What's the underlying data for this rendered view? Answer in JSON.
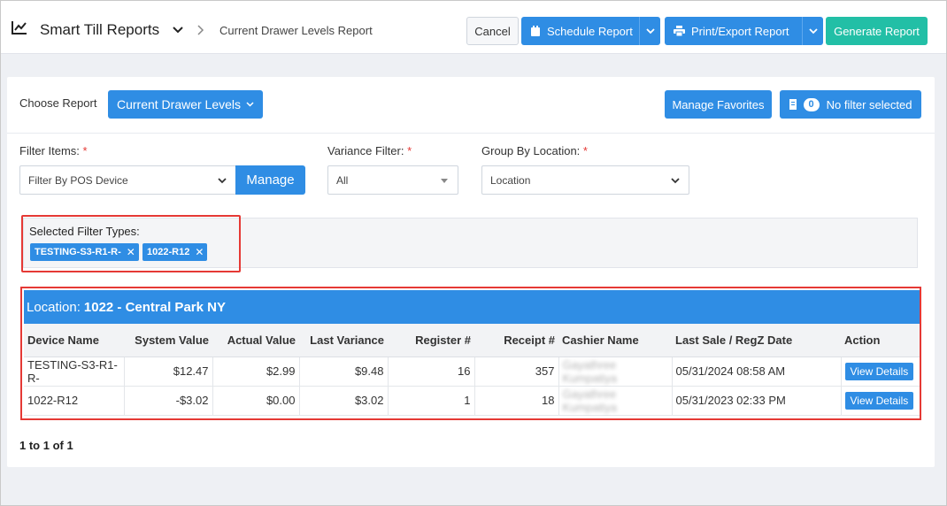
{
  "header": {
    "app_title": "Smart Till Reports",
    "breadcrumb": "Current Drawer Levels Report",
    "cancel_label": "Cancel",
    "schedule_label": "Schedule Report",
    "print_label": "Print/Export Report",
    "generate_label": "Generate Report"
  },
  "report_select": {
    "label": "Choose Report",
    "value": "Current Drawer Levels",
    "manage_favorites": "Manage Favorites",
    "filter_count": "0",
    "filter_status": "No filter selected"
  },
  "filters": {
    "items_label": "Filter Items:",
    "items_value": "Filter By POS Device",
    "manage_label": "Manage",
    "variance_label": "Variance Filter:",
    "variance_value": "All",
    "group_label": "Group By Location:",
    "group_value": "Location",
    "required_mark": "*"
  },
  "selected_filters": {
    "label": "Selected Filter Types:",
    "chips": [
      "TESTING-S3-R1-R-",
      "1022-R12"
    ]
  },
  "location": {
    "prefix": "Location:",
    "name": "1022 - Central Park NY"
  },
  "table": {
    "headers": [
      "Device Name",
      "System Value",
      "Actual Value",
      "Last Variance",
      "Register #",
      "Receipt #",
      "Cashier Name",
      "Last Sale / RegZ Date",
      "Action"
    ],
    "rows": [
      {
        "device": "TESTING-S3-R1-R-",
        "system": "$12.47",
        "actual": "$2.99",
        "variance": "$9.48",
        "register": "16",
        "receipt": "357",
        "cashier": "Gayathree Kumpatiya",
        "date": "05/31/2024 08:58 AM",
        "action": "View Details"
      },
      {
        "device": "1022-R12",
        "system": "-$3.02",
        "actual": "$0.00",
        "variance": "$3.02",
        "register": "1",
        "receipt": "18",
        "cashier": "Gayathree Kumpatiya",
        "date": "05/31/2023 02:33 PM",
        "action": "View Details"
      }
    ]
  },
  "pager": "1 to 1 of 1",
  "colors": {
    "primary": "#2f8de4",
    "accent": "#22bfa6",
    "highlight": "#e53935"
  }
}
